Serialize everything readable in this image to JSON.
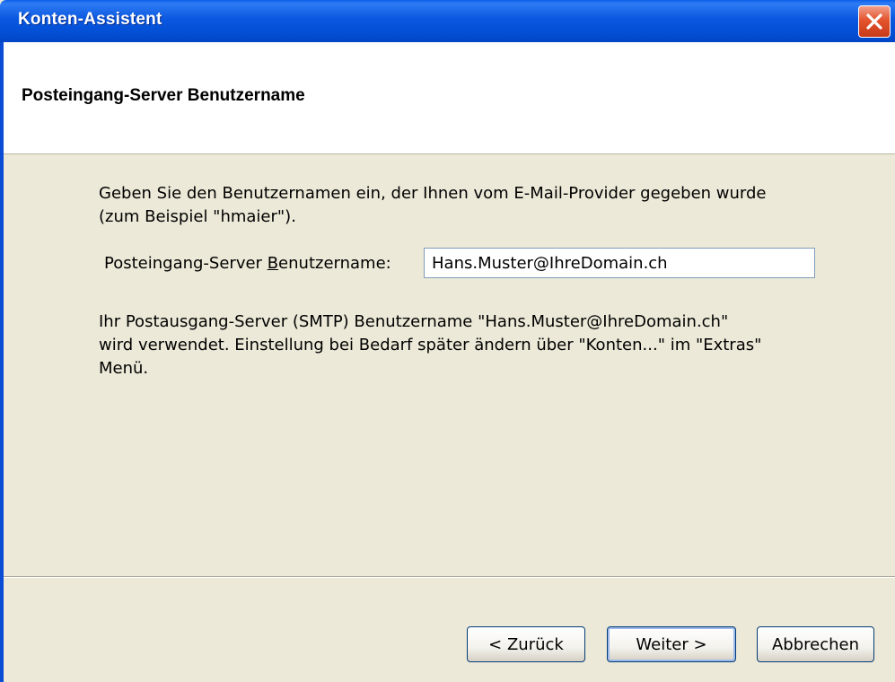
{
  "window": {
    "title": "Konten-Assistent"
  },
  "header": {
    "title": "Posteingang-Server Benutzername"
  },
  "content": {
    "intro_line1": "Geben Sie den Benutzernamen ein, der Ihnen vom E-Mail-Provider gegeben wurde",
    "intro_line2": "(zum Beispiel \"hmaier\").",
    "username_label_before": "Posteingang-Server ",
    "username_label_accel": "B",
    "username_label_after": "enutzername:",
    "username_value": "Hans.Muster@IhreDomain.ch",
    "info_line1": "Ihr Postausgang-Server (SMTP) Benutzername \"Hans.Muster@IhreDomain.ch\"",
    "info_line2": "wird verwendet. Einstellung bei Bedarf später ändern über \"Konten...\" im \"Extras\"",
    "info_line3": "Menü."
  },
  "buttons": {
    "back": "< Zurück",
    "next": "Weiter >",
    "cancel": "Abbrechen"
  },
  "icons": {
    "close": "close-icon"
  },
  "colors": {
    "titlebar": "#0A58E0",
    "close": "#E3542E",
    "dialog_bg": "#ECE9D8"
  }
}
